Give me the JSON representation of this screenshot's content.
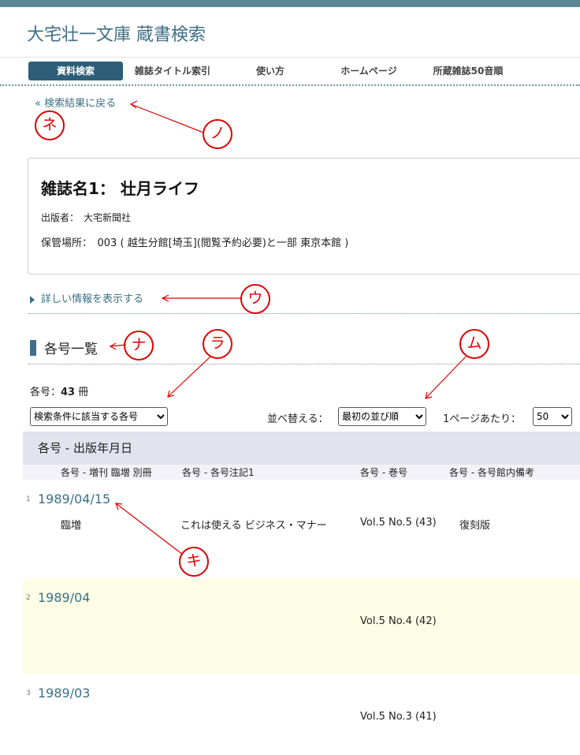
{
  "site": {
    "title": "大宅壮一文庫 蔵書検索"
  },
  "nav": [
    {
      "label": "資料検索",
      "active": true
    },
    {
      "label": "雑誌タイトル索引"
    },
    {
      "label": "使い方"
    },
    {
      "label": "ホームページ"
    },
    {
      "label": "所蔵雑誌50音順"
    }
  ],
  "back_link": "« 検索結果に戻る",
  "magazine": {
    "title": "雑誌名1： 壮月ライフ",
    "publisher": "出版者：　大宅新聞社",
    "location": "保管場所：　003 ( 越生分館[埼玉](閲覧予約必要)と一部 東京本館 )"
  },
  "detail_link": "詳しい情報を表示する",
  "section": {
    "title": "各号一覧"
  },
  "count": {
    "label": "各号：",
    "value": "43",
    "unit": " 冊"
  },
  "controls": {
    "filter": "検索条件に該当する各号",
    "sort_label": "並べ替える：",
    "sort_value": "最初の並び順",
    "per_page_label": "1ページあたり：",
    "per_page_value": "50"
  },
  "table": {
    "main_header": "各号 - 出版年月日",
    "headers": [
      "各号 - 増刊 臨増 別冊",
      "各号 - 各号注記1",
      "各号 - 巻号",
      "各号 - 各号館内備考"
    ],
    "rows": [
      {
        "num": "1",
        "date": "1989/04/15",
        "extra": "臨増",
        "note": "これは使える ビジネス・マナー",
        "volume": "Vol.5 No.5 (43)",
        "remark": "復刻版"
      },
      {
        "num": "2",
        "date": "1989/04",
        "extra": "",
        "note": "",
        "volume": "Vol.5 No.4 (42)",
        "remark": ""
      },
      {
        "num": "3",
        "date": "1989/03",
        "extra": "",
        "note": "",
        "volume": "Vol.5 No.3 (41)",
        "remark": ""
      }
    ]
  },
  "annotations": {
    "ne": "ネ",
    "no": "ノ",
    "u": "ウ",
    "na": "ナ",
    "ra": "ラ",
    "mu": "ム",
    "ki": "キ",
    "color": "#e00000"
  }
}
